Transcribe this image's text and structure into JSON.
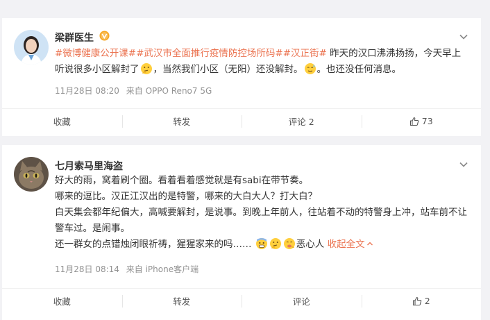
{
  "posts": [
    {
      "author": "梁群医生",
      "verified_badge": "gold-v-badge",
      "body_parts": [
        {
          "t": "#微博健康公开课#",
          "c": "tag"
        },
        {
          "t": "#武汉市全面推行疫情防控场所码#",
          "c": "tag"
        },
        {
          "t": "#汉正街#",
          "c": "tag"
        },
        {
          "t": " 昨天的汉口沸沸扬扬，今天早上听说很多小区解封了",
          "c": "text"
        },
        {
          "t": "thinking-emoji",
          "c": "emoji"
        },
        {
          "t": "，当然我们小区（无阳）还没解封。",
          "c": "text"
        },
        {
          "t": "sweat-emoji",
          "c": "emoji"
        },
        {
          "t": "。也还没任何消息。",
          "c": "text"
        }
      ],
      "time": "11月28日 08:20",
      "source": "来自 OPPO Reno7 5G",
      "actions": {
        "favorite": "收藏",
        "repost": "转发",
        "comment": "评论 2",
        "like": "73"
      }
    },
    {
      "author": "七月索马里海盗",
      "lines": [
        "好大的雨，窝着刷个圈。看着看着感觉就是有sabi在带节奏。",
        "哪来的逗比。汉正江汉出的是特警，哪来的大白大人？打大白？",
        "白天集会都年纪偏大，高喊要解封，是说事。到晚上年前人，往站着不动的特警身上冲，站车前不让警车过。是闹事。",
        "还一群女的点错烛闭眼祈祷，猩猩家来的吗……"
      ],
      "last_line_suffix": "恶心人",
      "expand_label": "收起全文",
      "time": "11月28日 08:14",
      "source": "来自 iPhone客户端",
      "actions": {
        "favorite": "收藏",
        "repost": "转发",
        "comment": "评论",
        "like": "2"
      }
    }
  ]
}
